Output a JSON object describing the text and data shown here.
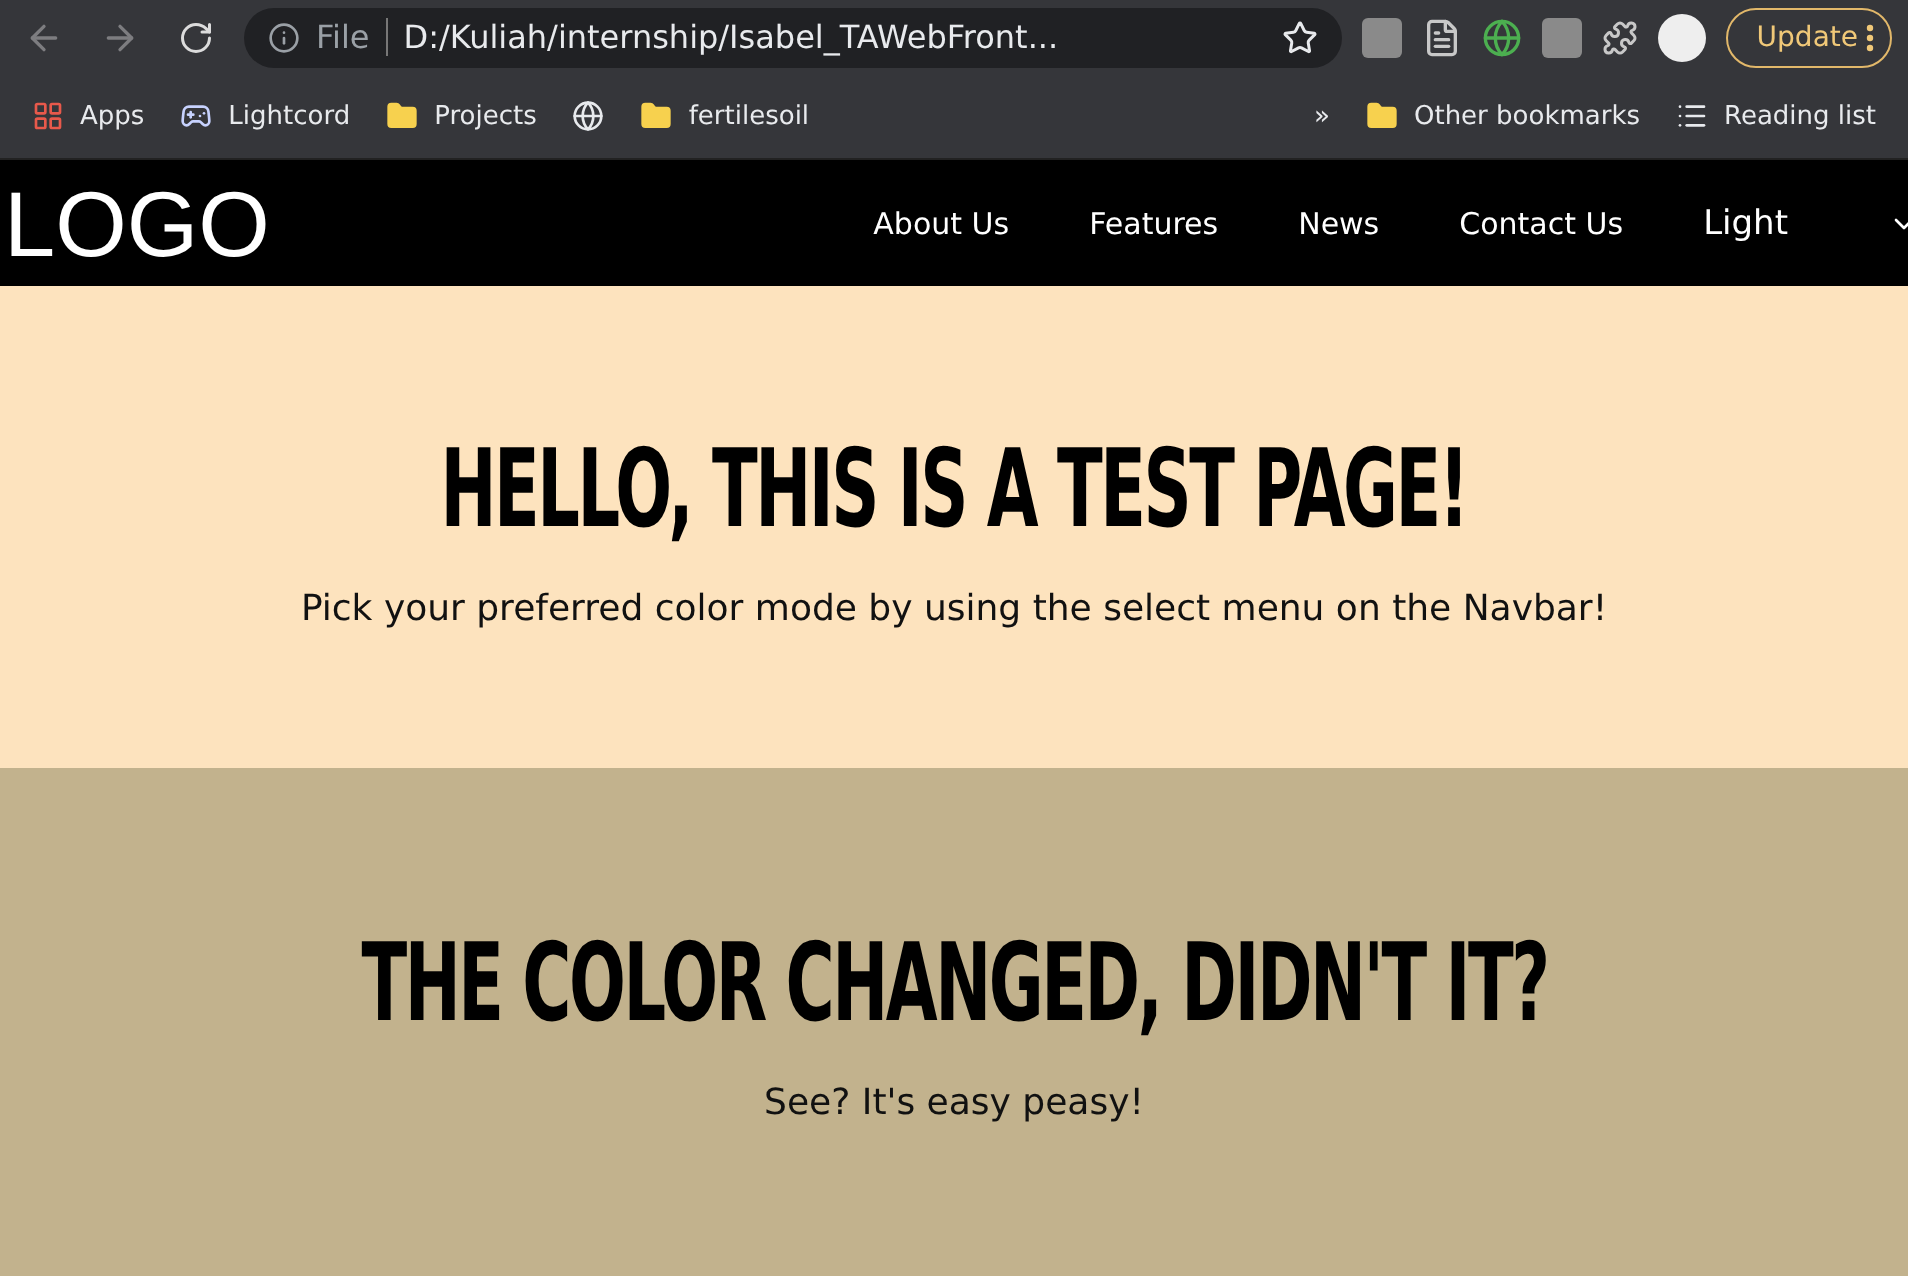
{
  "browser": {
    "address_prefix": "File",
    "address": "D:/Kuliah/internship/Isabel_TAWebFront...",
    "update_button": "Update"
  },
  "bookmarks": [
    {
      "label": "Apps",
      "kind": "apps"
    },
    {
      "label": "Lightcord",
      "kind": "app"
    },
    {
      "label": "Projects",
      "kind": "folder"
    },
    {
      "kind": "site"
    },
    {
      "label": "fertilesoil",
      "kind": "folder"
    }
  ],
  "bookmarks_more": "»",
  "bookmarks_right": [
    {
      "label": "Other bookmarks",
      "kind": "folder"
    },
    {
      "label": "Reading list",
      "kind": "list"
    }
  ],
  "navbar": {
    "logo": "LOGO",
    "links": [
      "About Us",
      "Features",
      "News",
      "Contact Us"
    ],
    "mode_select": "Light"
  },
  "sections": [
    {
      "heading": "HELLO, THIS IS A TEST PAGE!",
      "text": "Pick your preferred color mode by using the select menu on the Navbar!",
      "color": "#fde3be"
    },
    {
      "heading": "THE COLOR CHANGED, DIDN'T IT?",
      "text": "See? It's easy peasy!",
      "color": "#c2b28d"
    }
  ]
}
